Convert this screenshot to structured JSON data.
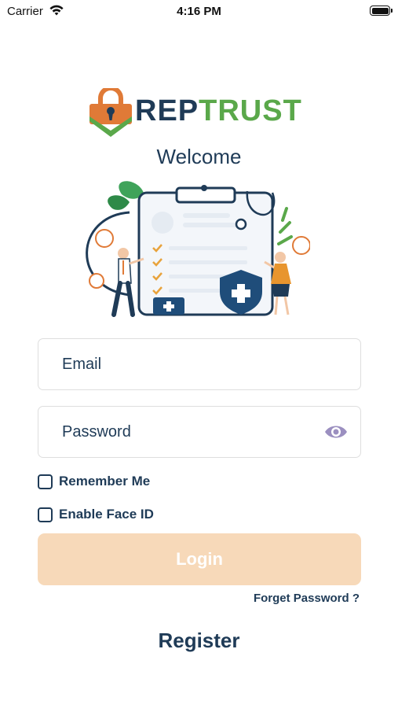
{
  "status_bar": {
    "carrier": "Carrier",
    "time": "4:16 PM"
  },
  "brand": {
    "name_part1": "REP",
    "name_part2": "TRUST",
    "color_primary": "#1f3b57",
    "color_accent": "#5aa84a",
    "color_lock": "#e07a37"
  },
  "welcome": "Welcome",
  "illustration": {
    "icon": "medical-clipboard-illustration"
  },
  "form": {
    "email_placeholder": "Email",
    "password_placeholder": "Password",
    "password_toggle_icon": "eye-icon",
    "remember_me": "Remember Me",
    "enable_face_id": "Enable Face ID",
    "login_label": "Login",
    "login_color": "#f7d9b9",
    "forgot_password": "Forget Password ?"
  },
  "register_label": "Register"
}
